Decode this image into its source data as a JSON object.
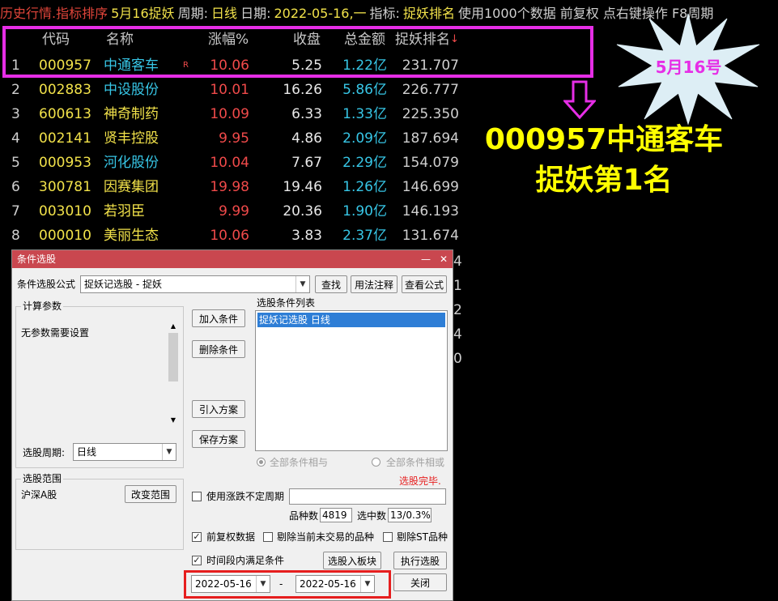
{
  "topbar": {
    "segments": [
      {
        "text": "历史行情.指标排序",
        "color": "red"
      },
      {
        "text": "5月16捉妖",
        "color": "yellow"
      },
      {
        "text": "周期:",
        "color": "gray"
      },
      {
        "text": "日线",
        "color": "yellow"
      },
      {
        "text": "日期:",
        "color": "gray"
      },
      {
        "text": "2022-05-16,一",
        "color": "yellow"
      },
      {
        "text": "指标:",
        "color": "gray"
      },
      {
        "text": "捉妖排名",
        "color": "yellow"
      },
      {
        "text": "使用1000个数据 前复权 点右键操作 F8周期",
        "color": "gray"
      }
    ]
  },
  "table": {
    "headers": {
      "code": "代码",
      "name": "名称",
      "pct": "涨幅%",
      "close": "收盘",
      "amount": "总金额",
      "rank": "捉妖排名",
      "sort_marker": "↓"
    },
    "rows": [
      {
        "idx": "1",
        "code": "000957",
        "name": "中通客车",
        "badge": "R",
        "pct": "10.06",
        "close": "5.25",
        "amount": "1.22亿",
        "rank": "231.707",
        "name_color": "cyan"
      },
      {
        "idx": "2",
        "code": "002883",
        "name": "中设股份",
        "badge": "",
        "pct": "10.01",
        "close": "16.26",
        "amount": "5.86亿",
        "rank": "226.777",
        "name_color": "cyan"
      },
      {
        "idx": "3",
        "code": "600613",
        "name": "神奇制药",
        "badge": "",
        "pct": "10.09",
        "close": "6.33",
        "amount": "1.33亿",
        "rank": "225.350",
        "name_color": "yellow"
      },
      {
        "idx": "4",
        "code": "002141",
        "name": "贤丰控股",
        "badge": "",
        "pct": "9.95",
        "close": "4.86",
        "amount": "2.09亿",
        "rank": "187.694",
        "name_color": "yellow"
      },
      {
        "idx": "5",
        "code": "000953",
        "name": "河化股份",
        "badge": "",
        "pct": "10.04",
        "close": "7.67",
        "amount": "2.29亿",
        "rank": "154.079",
        "name_color": "cyan"
      },
      {
        "idx": "6",
        "code": "300781",
        "name": "因赛集团",
        "badge": "",
        "pct": "19.98",
        "close": "19.46",
        "amount": "1.26亿",
        "rank": "146.699",
        "name_color": "yellow"
      },
      {
        "idx": "7",
        "code": "003010",
        "name": "若羽臣",
        "badge": "",
        "pct": "9.99",
        "close": "20.36",
        "amount": "1.90亿",
        "rank": "146.193",
        "name_color": "yellow"
      },
      {
        "idx": "8",
        "code": "000010",
        "name": "美丽生态",
        "badge": "",
        "pct": "10.06",
        "close": "3.83",
        "amount": "2.37亿",
        "rank": "131.674",
        "name_color": "yellow"
      }
    ],
    "hidden_rank_tails": [
      "4",
      "1",
      "2",
      "4",
      "0"
    ]
  },
  "annotation": {
    "burst_text": "5月16号",
    "big_line1": "000957中通客车",
    "big_line2": "捉妖第1名",
    "highlight_color": "#e62ee6",
    "big_text_color": "#ffff00"
  },
  "dialog": {
    "title": "条件选股",
    "minimize": "—",
    "close": "✕",
    "formula_label": "条件选股公式",
    "formula_value": "捉妖记选股   - 捉妖",
    "btn_find": "查找",
    "btn_usage": "用法注释",
    "btn_view": "查看公式",
    "params_group": "计算参数",
    "params_text": "无参数需要设置",
    "btn_add": "加入条件",
    "btn_delete": "删除条件",
    "btn_import": "引入方案",
    "btn_save": "保存方案",
    "cond_list_label": "选股条件列表",
    "cond_item": "捉妖记选股  日线",
    "period_label": "选股周期:",
    "period_value": "日线",
    "radio_and": "全部条件相与",
    "radio_or": "全部条件相或",
    "status": "选股完毕.",
    "range_group": "选股范围",
    "range_value": "沪深A股",
    "btn_change_range": "改变范围",
    "chk_uncertain": "使用涨跌不定周期",
    "count_label": "品种数",
    "count_value": "4819",
    "selected_label": "选中数",
    "selected_value": "13/0.3%",
    "chk_fq": "前复权数据",
    "chk_untraded": "剔除当前未交易的品种",
    "chk_st": "剔除ST品种",
    "chk_period": "时间段内满足条件",
    "btn_to_block": "选股入板块",
    "btn_run": "执行选股",
    "date_from": "2022-05-16",
    "date_dash": "-",
    "date_to": "2022-05-16",
    "btn_close": "关闭"
  }
}
